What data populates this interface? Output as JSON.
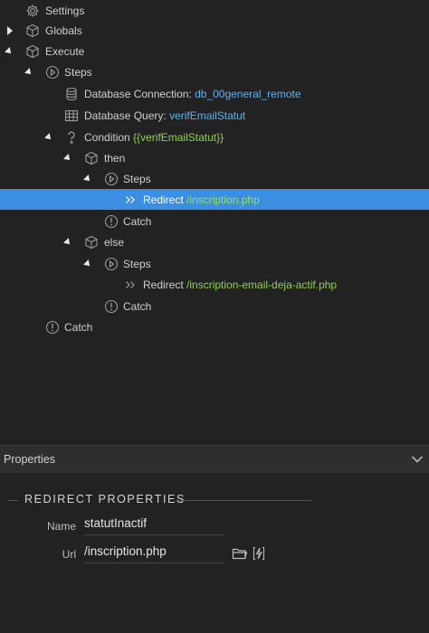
{
  "tree": {
    "settings": "Settings",
    "globals": "Globals",
    "execute": "Execute",
    "steps": "Steps",
    "db_connection_label": "Database Connection:",
    "db_connection_value": "db_00general_remote",
    "db_query_label": "Database Query:",
    "db_query_value": "verifEmailStatut",
    "condition_label": "Condition",
    "condition_value": "{{verifEmailStatut}}",
    "then": "then",
    "then_steps": "Steps",
    "redirect1_label": "Redirect",
    "redirect1_value": "/inscription.php",
    "then_catch": "Catch",
    "else": "else",
    "else_steps": "Steps",
    "redirect2_label": "Redirect",
    "redirect2_value": "/inscription-email-deja-actif.php",
    "else_catch": "Catch",
    "catch": "Catch"
  },
  "properties": {
    "header": "Properties",
    "section_title": "REDIRECT PROPERTIES",
    "name_label": "Name",
    "name_value": "statutInactif",
    "url_label": "Url",
    "url_value": "/inscription.php"
  },
  "icons": {
    "settings": "gear-icon",
    "globals": "cube-icon",
    "execute": "cube-icon",
    "steps": "play-circle-icon",
    "database": "database-icon",
    "query": "table-icon",
    "condition": "question-icon",
    "redirect": "double-chevron-icon",
    "catch": "exclamation-circle-icon",
    "folder": "folder-icon",
    "dynamic": "lightning-icon"
  },
  "colors": {
    "selection": "#3c8fe0",
    "value_blue": "#5db2f0",
    "value_green": "#8fd14f"
  }
}
